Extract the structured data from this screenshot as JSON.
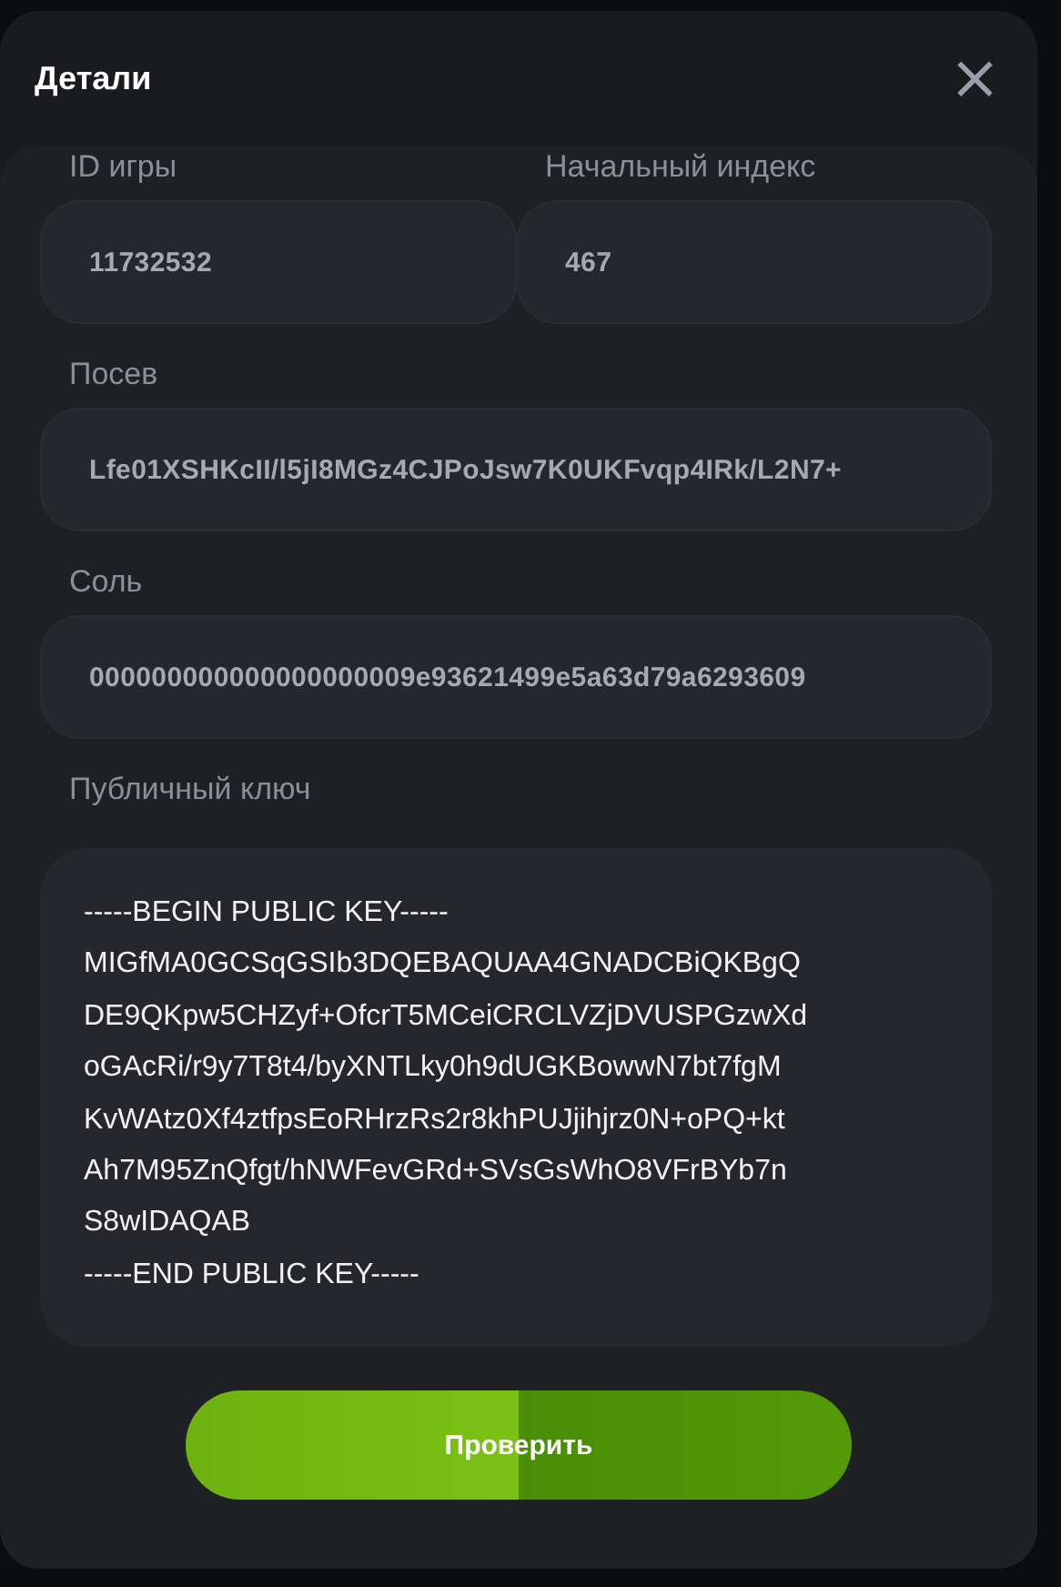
{
  "dialog": {
    "title": "Детали",
    "close_icon": "×"
  },
  "fields": [
    {
      "kind": "pair",
      "items": [
        {
          "label": "ID игры",
          "value": "11732532"
        },
        {
          "label": "Начальный индекс",
          "value": "467"
        }
      ]
    },
    {
      "kind": "single",
      "items": [
        {
          "label": "Посев",
          "value": "Lfe01XSHKcII/l5jI8MGz4CJPoJsw7K0UKFvqp4IRk/L2N7+"
        }
      ]
    },
    {
      "kind": "single",
      "items": [
        {
          "label": "Соль",
          "value": "000000000000000000009e93621499e5a63d79a6293609"
        }
      ]
    },
    {
      "kind": "multiline",
      "items": [
        {
          "label": "Публичный ключ",
          "value": "-----BEGIN PUBLIC KEY-----\nMIGfMA0GCSqGSIb3DQEBAQUAA4GNADCBiQKBgQ\nDE9QKpw5CHZyf+OfcrT5MCeiCRCLVZjDVUSPGzwXd\noGAcRi/r9y7T8t4/byXNTLky0h9dUGKBowwN7bt7fgM\nKvWAtz0Xf4ztfpsEoRHrzRs2r8khPUJjihjrz0N+oPQ+kt\nAh7M95ZnQfgt/hNWFevGRd+SVsGsWhO8VFrBYb7n\nS8wIDAQAB\n-----END PUBLIC KEY-----"
        }
      ]
    }
  ],
  "verify_button": {
    "label": "Проверить"
  }
}
